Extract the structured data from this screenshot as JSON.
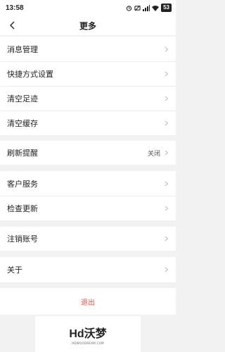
{
  "status_bar": {
    "time": "13:58",
    "battery": "53",
    "icons": [
      "alarm-icon",
      "mute-icon",
      "signal-icon",
      "wifi-icon",
      "battery-icon"
    ]
  },
  "header": {
    "title": "更多"
  },
  "groups": [
    {
      "items": [
        {
          "label": "消息管理"
        },
        {
          "label": "快捷方式设置"
        },
        {
          "label": "清空足迹"
        },
        {
          "label": "清空缓存"
        }
      ]
    },
    {
      "items": [
        {
          "label": "刷新提醒",
          "value": "关闭"
        }
      ]
    },
    {
      "items": [
        {
          "label": "客户服务"
        },
        {
          "label": "检查更新"
        }
      ]
    },
    {
      "items": [
        {
          "label": "注销账号"
        }
      ]
    },
    {
      "items": [
        {
          "label": "关于"
        }
      ]
    }
  ],
  "logout_label": "退出",
  "colors": {
    "accent": "#e8553e",
    "background": "#f2f2f2"
  },
  "watermark": {
    "main": "Hd沃梦",
    "sub": "HDWOODREAM.COM"
  }
}
